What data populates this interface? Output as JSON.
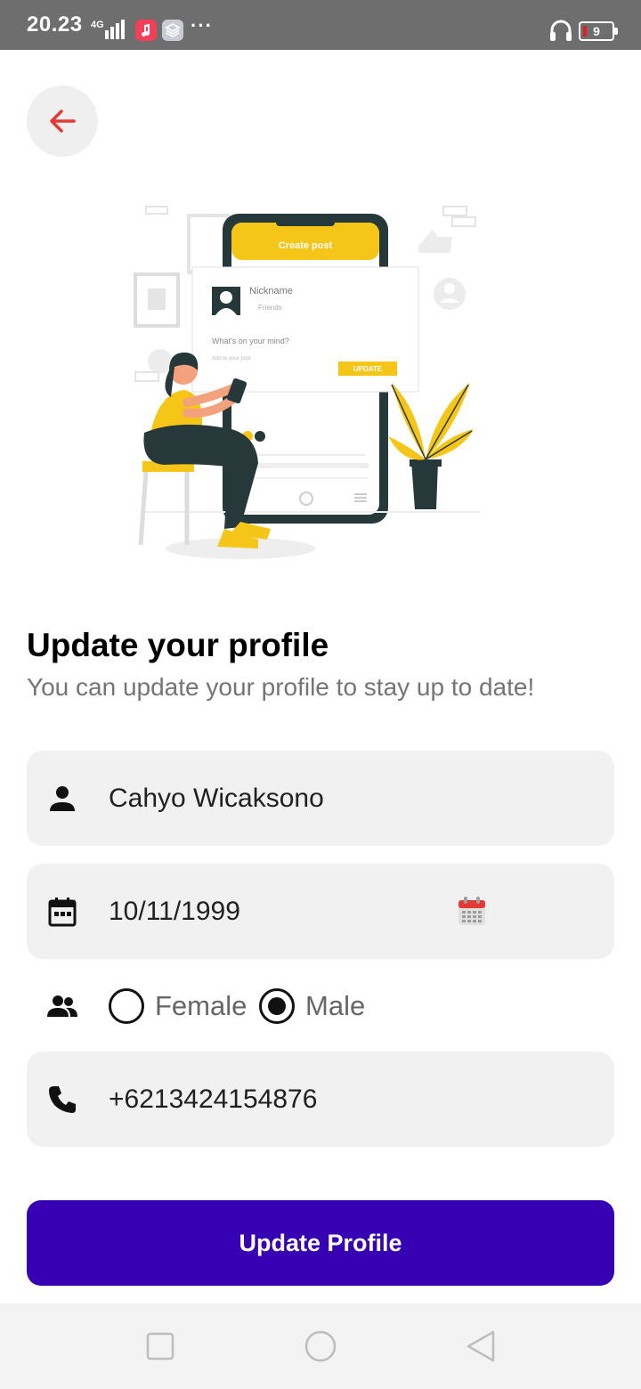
{
  "status_bar": {
    "time": "20.23",
    "network": "4G",
    "battery": "9",
    "icons": [
      "signal-icon",
      "music-app-icon",
      "stack-app-icon",
      "more-dots-icon",
      "headset-icon",
      "battery-icon"
    ],
    "dots": "···"
  },
  "header": {
    "back_icon": "arrow-left-icon",
    "back_color": "#e53935"
  },
  "illustration": {
    "post_title": "Create post",
    "nickname": "Nickname",
    "audience": "Friends",
    "prompt": "What's on your mind?",
    "add_to_post": "Add to your post",
    "update_label": "UPDATE"
  },
  "page": {
    "title": "Update your profile",
    "subtitle": "You can update your profile to stay up to date!"
  },
  "form": {
    "name": {
      "icon": "person-icon",
      "value": "Cahyo Wicaksono"
    },
    "birthdate": {
      "icon": "calendar-icon",
      "value": "10/11/1999",
      "picker_icon": "calendar-picker-icon"
    },
    "gender": {
      "icon": "people-icon",
      "options": [
        "Female",
        "Male"
      ],
      "selected": "Male"
    },
    "phone": {
      "icon": "phone-icon",
      "value": "+6213424154876"
    }
  },
  "actions": {
    "update_label": "Update Profile",
    "color": "#3700b3"
  },
  "nav": {
    "icons": [
      "recent-apps-icon",
      "home-icon",
      "back-icon"
    ]
  }
}
